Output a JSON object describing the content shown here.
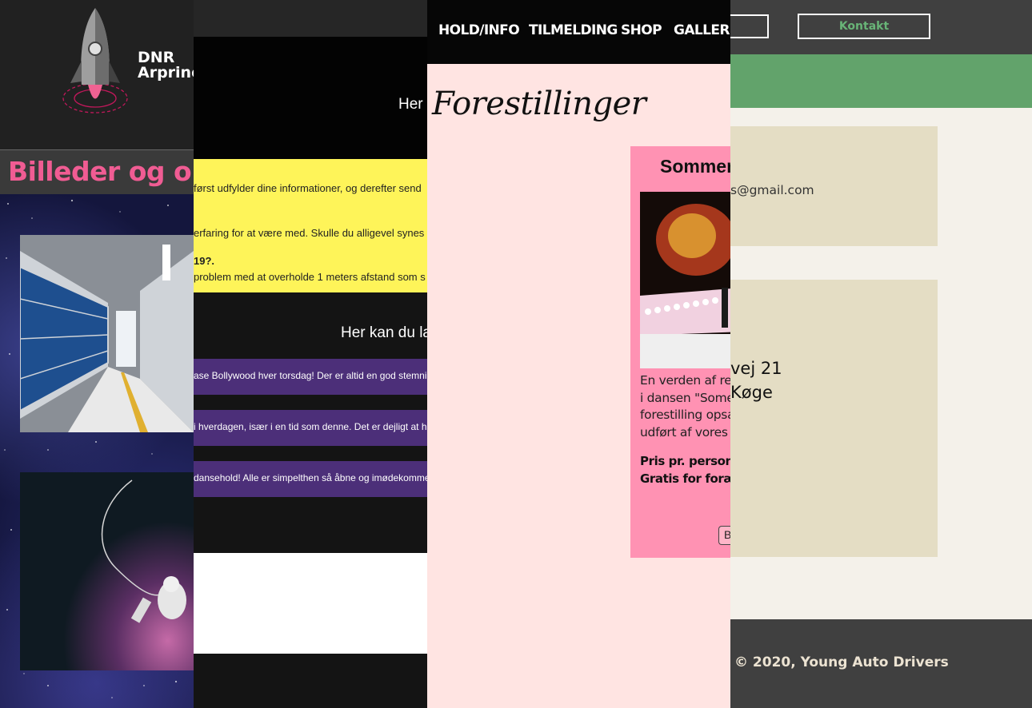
{
  "panel_rocket": {
    "brand_line1": "DNR",
    "brand_line2": "Arprinc",
    "page_title": "Billeder og op"
  },
  "panel_dark": {
    "heading_top": "Her",
    "yellow_lines": [
      "først udfylder dine informationer, og derefter send",
      "erfaring for at være med. Skulle du alligevel synes",
      "19?.",
      "problem med at overholde 1 meters afstand som s"
    ],
    "heading_reviews": "Her kan du læ",
    "reviews": [
      "ase Bollywood hver torsdag! Der er altid en god stemning og m",
      "i hverdagen, især i en tid som denne. Det er dejligt at have et",
      "dansehold! Alle er simpelthen så åbne og imødekommende, o"
    ]
  },
  "panel_dance": {
    "nav": [
      "HOLD/INFO",
      "TILMELDING",
      "SHOP",
      "GALLERI"
    ],
    "heading": "Forestillinger",
    "card": {
      "title": "Sommer",
      "desc_lines": [
        "En verden af re",
        "i dansen \"Somer",
        "forestilling opsa",
        "udført af vores"
      ],
      "price_lines": [
        "Pris pr. person:",
        "Gratis for foræld"
      ],
      "button": "B"
    },
    "colors": {
      "background": "#ffe4e2",
      "card": "#ff92b3"
    }
  },
  "panel_auto": {
    "kontakt_button": "Kontakt",
    "email": "s@gmail.com",
    "address_line1": "vej 21",
    "address_line2": "Køge",
    "footer": "© 2020, Young Auto Drivers",
    "colors": {
      "green_band": "#62a36b",
      "button_text": "#68b477",
      "info_box": "#e4ddc4"
    }
  }
}
